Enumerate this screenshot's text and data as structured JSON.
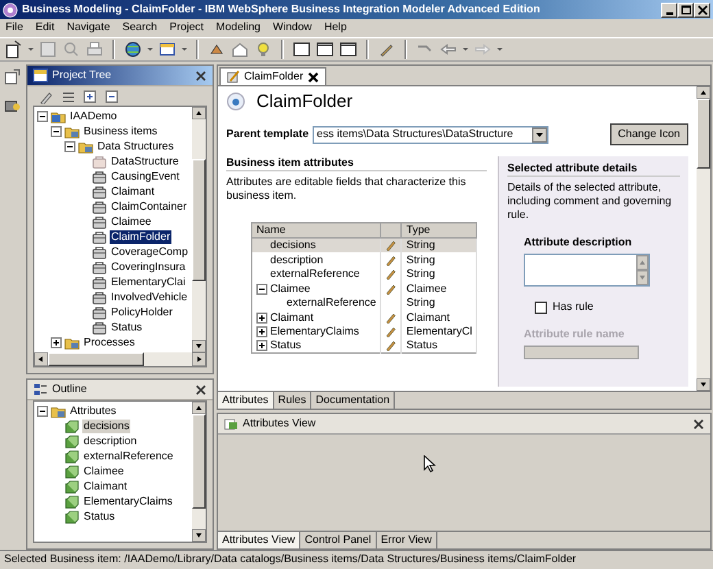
{
  "window": {
    "title": "Business Modeling - ClaimFolder - IBM WebSphere Business Integration Modeler Advanced Edition"
  },
  "menu": [
    "File",
    "Edit",
    "Navigate",
    "Search",
    "Project",
    "Modeling",
    "Window",
    "Help"
  ],
  "project_tree": {
    "title": "Project Tree",
    "active": true,
    "tree": [
      {
        "label": "IAADemo",
        "kind": "project",
        "expanded": true,
        "selected": false,
        "children": [
          {
            "label": "Business items",
            "kind": "folder",
            "expanded": true,
            "selected": false,
            "children": [
              {
                "label": "Data Structures",
                "kind": "folder",
                "expanded": true,
                "selected": false,
                "children": [
                  {
                    "label": "DataStructure",
                    "kind": "template",
                    "selected": false
                  },
                  {
                    "label": "CausingEvent",
                    "kind": "item",
                    "selected": false
                  },
                  {
                    "label": "Claimant",
                    "kind": "item",
                    "selected": false
                  },
                  {
                    "label": "ClaimContainer",
                    "kind": "item",
                    "selected": false
                  },
                  {
                    "label": "Claimee",
                    "kind": "item",
                    "selected": false
                  },
                  {
                    "label": "ClaimFolder",
                    "kind": "item",
                    "selected": true
                  },
                  {
                    "label": "CoverageComp",
                    "kind": "item",
                    "selected": false
                  },
                  {
                    "label": "CoveringInsura",
                    "kind": "item",
                    "selected": false
                  },
                  {
                    "label": "ElementaryClai",
                    "kind": "item",
                    "selected": false
                  },
                  {
                    "label": "InvolvedVehicle",
                    "kind": "item",
                    "selected": false
                  },
                  {
                    "label": "PolicyHolder",
                    "kind": "item",
                    "selected": false
                  },
                  {
                    "label": "Status",
                    "kind": "item",
                    "selected": false
                  }
                ]
              }
            ]
          },
          {
            "label": "Processes",
            "kind": "folder",
            "expanded": false,
            "selected": false
          }
        ]
      }
    ]
  },
  "outline": {
    "title": "Outline",
    "active": false,
    "tree": [
      {
        "label": "Attributes",
        "kind": "folder",
        "expanded": true,
        "selected": false,
        "children": [
          {
            "label": "decisions",
            "kind": "attribute",
            "selected": true
          },
          {
            "label": "description",
            "kind": "attribute",
            "selected": false
          },
          {
            "label": "externalReference",
            "kind": "attribute",
            "selected": false
          },
          {
            "label": "Claimee",
            "kind": "attribute",
            "selected": false
          },
          {
            "label": "Claimant",
            "kind": "attribute",
            "selected": false
          },
          {
            "label": "ElementaryClaims",
            "kind": "attribute",
            "selected": false
          },
          {
            "label": "Status",
            "kind": "attribute",
            "selected": false
          }
        ]
      }
    ]
  },
  "editor": {
    "tab": "ClaimFolder",
    "title": "ClaimFolder",
    "parent_template": {
      "label": "Parent template",
      "value": "ess items\\Data Structures\\DataStructure"
    },
    "change_icon_button": "Change Icon",
    "attributes": {
      "heading": "Business item attributes",
      "description": "Attributes are editable fields that characterize this business item.",
      "columns": [
        "Name",
        "Type"
      ],
      "rows": [
        {
          "name": "decisions",
          "type": "String",
          "editable": true,
          "selected": true
        },
        {
          "name": "description",
          "type": "String",
          "editable": true,
          "selected": false
        },
        {
          "name": "externalReference",
          "type": "String",
          "editable": true,
          "selected": false
        },
        {
          "name": "Claimee",
          "type": "Claimee",
          "editable": true,
          "selected": false,
          "expanded": true,
          "children": [
            {
              "name": "externalReference",
              "type": "String",
              "editable": false,
              "selected": false
            }
          ]
        },
        {
          "name": "Claimant",
          "type": "Claimant",
          "editable": true,
          "selected": false,
          "expanded": false
        },
        {
          "name": "ElementaryClaims",
          "type": "ElementaryCl",
          "editable": true,
          "selected": false,
          "expanded": false
        },
        {
          "name": "Status",
          "type": "Status",
          "editable": true,
          "selected": false,
          "expanded": false
        }
      ]
    },
    "details": {
      "heading": "Selected attribute details",
      "description": "Details of the selected attribute, including comment and governing rule.",
      "description_label": "Attribute description",
      "has_rule": {
        "label": "Has rule",
        "checked": false
      },
      "rule_name": {
        "label": "Attribute rule name",
        "disabled": true
      }
    },
    "tabs": [
      {
        "label": "Attributes",
        "selected": true
      },
      {
        "label": "Rules",
        "selected": false
      },
      {
        "label": "Documentation",
        "selected": false
      }
    ]
  },
  "attributes_view": {
    "title": "Attributes View",
    "tabs": [
      {
        "label": "Attributes View",
        "selected": true
      },
      {
        "label": "Control Panel",
        "selected": false
      },
      {
        "label": "Error View",
        "selected": false
      }
    ]
  },
  "status_bar": "Selected Business item: /IAADemo/Library/Data catalogs/Business items/Data Structures/Business items/ClaimFolder"
}
